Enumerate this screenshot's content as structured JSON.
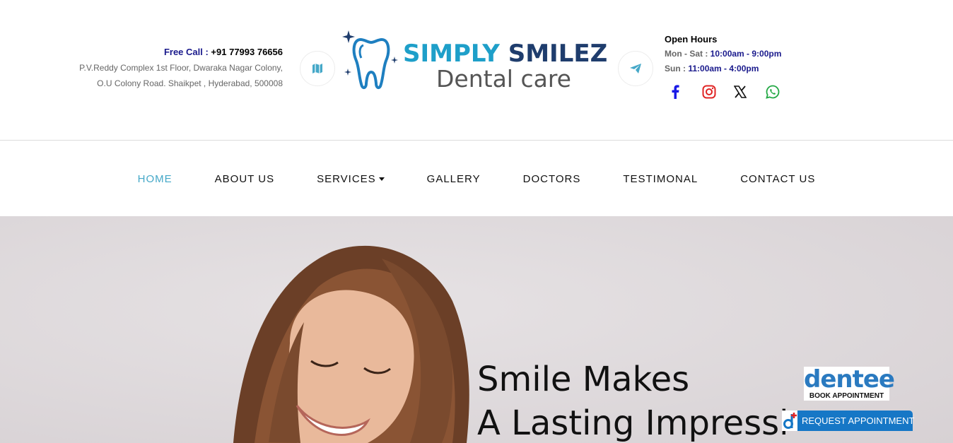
{
  "contact": {
    "free_call_label": "Free Call :",
    "phone": "+91 77993 76656",
    "address_line1": "P.V.Reddy Complex 1st Floor, Dwaraka Nagar Colony,",
    "address_line2": "O.U Colony Road. Shaikpet , Hyderabad, 500008"
  },
  "logo": {
    "title_part1": "SIMPLY ",
    "title_part2": "SMILEZ",
    "subtitle": "Dental care"
  },
  "hours": {
    "title": "Open Hours",
    "weekday_label": "Mon - Sat :",
    "weekday_value": "10:00am - 9:00pm",
    "sunday_label": "Sun :",
    "sunday_value": "11:00am - 4:00pm"
  },
  "icons": {
    "map": "map-icon",
    "telegram": "paper-plane-icon",
    "facebook": "facebook-icon",
    "instagram": "instagram-icon",
    "x": "x-twitter-icon",
    "whatsapp": "whatsapp-icon"
  },
  "nav": {
    "items": [
      {
        "label": "HOME",
        "active": true
      },
      {
        "label": "ABOUT US"
      },
      {
        "label": "SERVICES",
        "dropdown": true
      },
      {
        "label": "GALLERY"
      },
      {
        "label": "DOCTORS"
      },
      {
        "label": "TESTIMONAL"
      },
      {
        "label": "CONTACT US"
      }
    ]
  },
  "hero": {
    "line1": "Smile Makes",
    "line2": "A Lasting Impressi"
  },
  "widgets": {
    "dentee_logo": "dentee",
    "dentee_sub": "BOOK APPOINTMENT",
    "request_label": "REQUEST APPOINTMENT"
  },
  "colors": {
    "accent": "#45a8c8",
    "navy": "#1a1a8c",
    "brand_blue": "#1e9fc9",
    "brand_dark": "#1f3d6d",
    "request_blue": "#1677c6"
  }
}
